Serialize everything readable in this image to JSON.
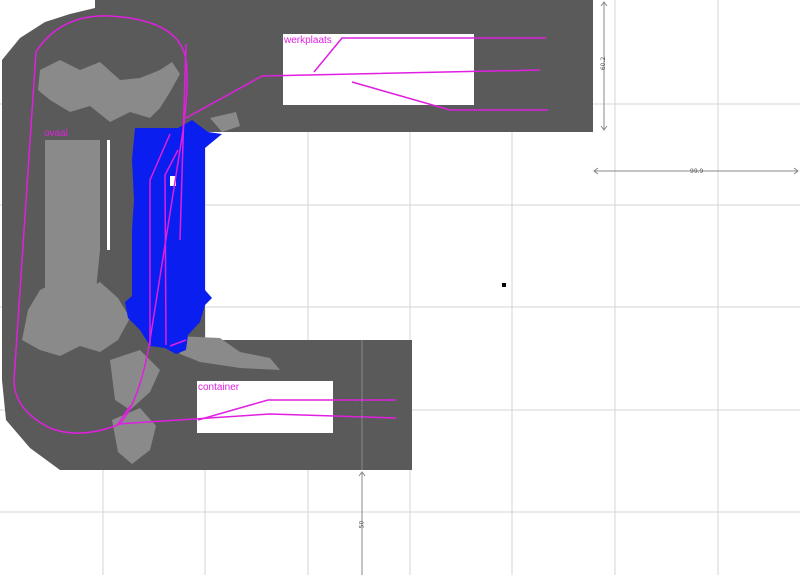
{
  "colors": {
    "background": "#ffffff",
    "grid": "#d4d4d4",
    "occupied": "#5a5a5a",
    "obstacle": "#8a8a8a",
    "free_cell": "#ffffff",
    "path": "#e01fe0",
    "robot": "#0a1ef0",
    "dimension": "#888888",
    "marker": "#000000"
  },
  "zones": {
    "werkplaats": "werkplaats",
    "container": "container",
    "ovaal": "ovaal"
  },
  "dimensions": {
    "vertical_top": "60.2",
    "horizontal_right": "99.9",
    "vertical_mid": "62",
    "vertical_bottom": "50"
  }
}
